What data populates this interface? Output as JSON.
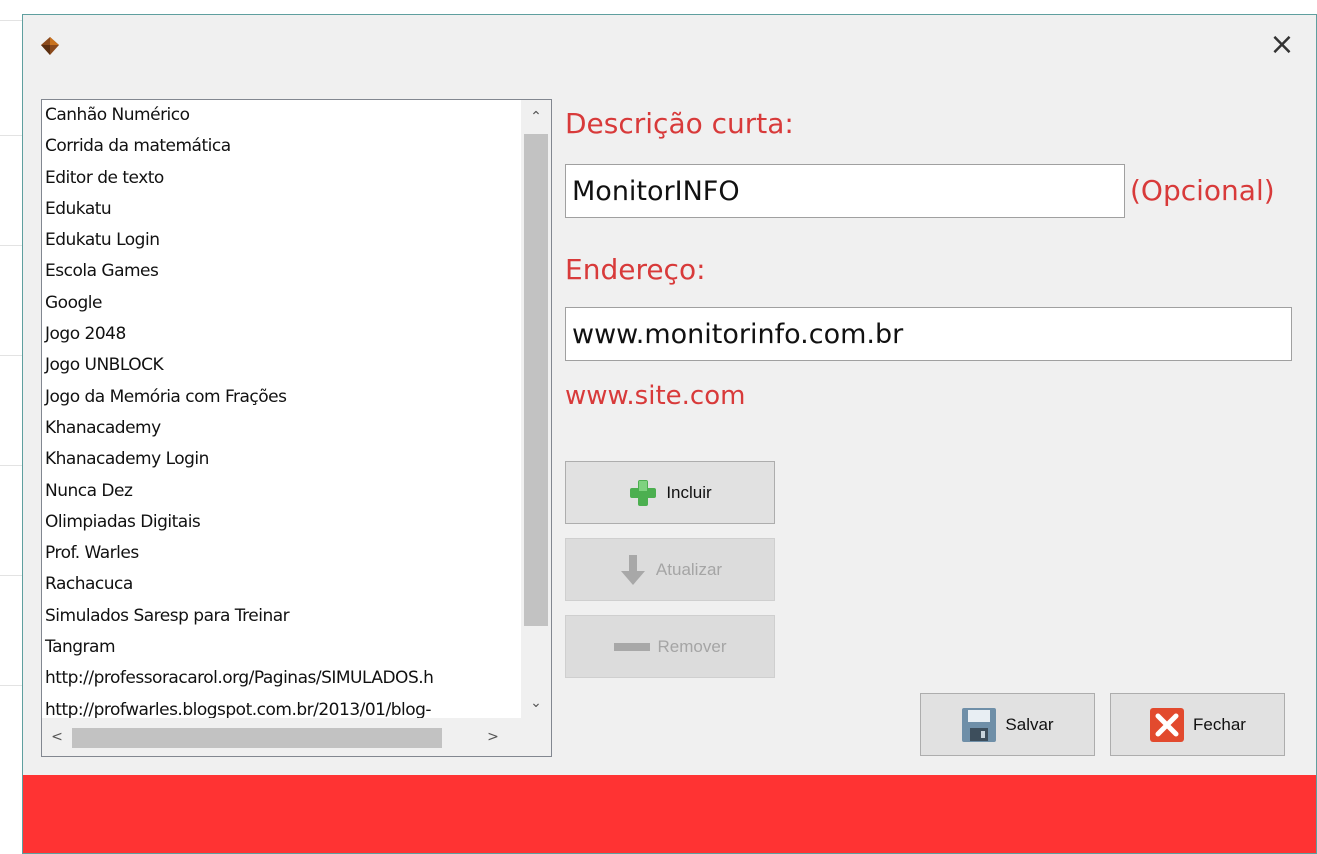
{
  "window": {
    "close_label": "×",
    "accent_color": "#ff3333"
  },
  "list": {
    "items": [
      "Canhão Numérico",
      "Corrida da matemática",
      "Editor de texto",
      "Edukatu",
      "Edukatu Login",
      "Escola Games",
      "Google",
      "Jogo 2048",
      "Jogo UNBLOCK",
      "Jogo da Memória com Frações",
      "Khanacademy",
      "Khanacademy Login",
      "Nunca Dez",
      "Olimpiadas Digitais",
      "Prof. Warles",
      "Rachacuca",
      "Simulados Saresp para Treinar",
      "Tangram",
      "http://professoracarol.org/Paginas/SIMULADOS.h",
      "http://profwarles.blogspot.com.br/2013/01/blog-"
    ]
  },
  "form": {
    "description_label": "Descrição curta:",
    "description_value": "MonitorINFO",
    "optional_label": "(Opcional)",
    "address_label": "Endereço:",
    "address_value": "www.monitorinfo.com.br",
    "address_hint": "www.site.com",
    "label_color": "#d83a3a"
  },
  "buttons": {
    "include": "Incluir",
    "update": "Atualizar",
    "remove": "Remover",
    "save": "Salvar",
    "close": "Fechar"
  }
}
